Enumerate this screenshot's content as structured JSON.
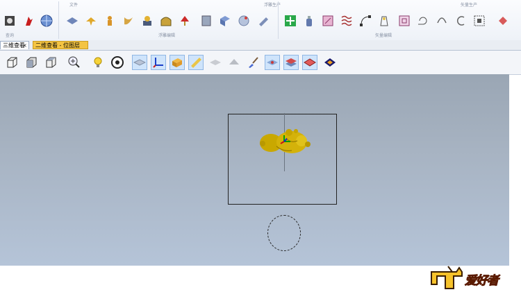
{
  "ribbon": {
    "groups": [
      {
        "title": "文件",
        "footer": "查询"
      },
      {
        "title": "",
        "footer": "浮雕编辑"
      },
      {
        "title": "浮雕生产",
        "footer": ""
      },
      {
        "title": "矢量生产",
        "footer": "矢量编辑"
      }
    ]
  },
  "tabs": [
    {
      "label": "三维查看",
      "close": "×"
    },
    {
      "label": "二维查看 - 位图层"
    }
  ],
  "logo": {
    "text": "爱好者",
    "mark": "木工"
  },
  "colors": {
    "model": "#c9a800",
    "viewport_top": "#9aa6b4",
    "viewport_bottom": "#b5c4d8",
    "active_tab": "#f4c443"
  }
}
